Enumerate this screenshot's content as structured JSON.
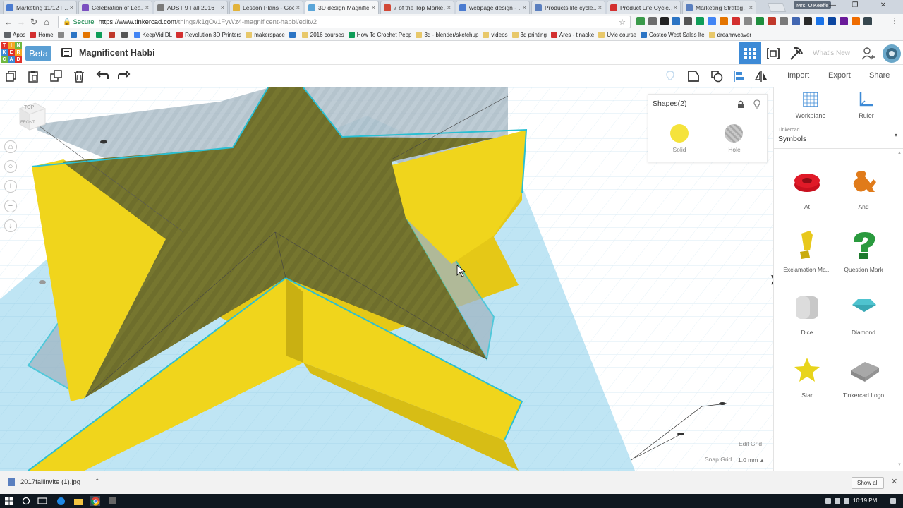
{
  "browser": {
    "tabs": [
      {
        "label": "Marketing 11/12 F…",
        "color": "#4a7bd0",
        "active": false
      },
      {
        "label": "Celebration of Lea…",
        "color": "#7b4fc0",
        "active": false
      },
      {
        "label": "ADST 9 Fall 2016",
        "color": "#7a7a7a",
        "active": false
      },
      {
        "label": "Lesson Plans - Goo…",
        "color": "#e2b33a",
        "active": false
      },
      {
        "label": "3D design Magnific…",
        "color": "#5aa5d8",
        "active": true
      },
      {
        "label": "7 of the Top Marke…",
        "color": "#d14836",
        "active": false
      },
      {
        "label": "webpage design - …",
        "color": "#4a7bd0",
        "active": false
      },
      {
        "label": "Products life cycle…",
        "color": "#5a7fbf",
        "active": false
      },
      {
        "label": "Product Life Cycle…",
        "color": "#d32f2f",
        "active": false
      },
      {
        "label": "Marketing Strateg…",
        "color": "#5a7fbf",
        "active": false
      }
    ],
    "tab_close": "×",
    "profile": "Mrs. O'Keeffe",
    "window_controls": {
      "minimize": "—",
      "maximize": "❐",
      "close": "✕"
    },
    "nav": {
      "back": "←",
      "forward": "→",
      "reload": "↻",
      "home": "⌂"
    },
    "secure_label": "🔒 Secure",
    "url_host": "https://www.tinkercad.com",
    "url_path": "/things/k1gOv1FyWz4-magnificent-habbi/editv2",
    "star": "☆",
    "bookmarks": [
      {
        "label": "Apps",
        "kind": "apps"
      },
      {
        "label": "Home",
        "kind": "site"
      },
      {
        "label": "",
        "kind": "site"
      },
      {
        "label": "",
        "kind": "site"
      },
      {
        "label": "",
        "kind": "site"
      },
      {
        "label": "",
        "kind": "site"
      },
      {
        "label": "",
        "kind": "site"
      },
      {
        "label": "",
        "kind": "site"
      },
      {
        "label": "KeepVid DL",
        "kind": "site"
      },
      {
        "label": "Revolution 3D Printers",
        "kind": "site"
      },
      {
        "label": "makerspace",
        "kind": "folder"
      },
      {
        "label": "",
        "kind": "site"
      },
      {
        "label": "2016 courses",
        "kind": "folder"
      },
      {
        "label": "How To Crochet Pepp",
        "kind": "site"
      },
      {
        "label": "3d - blender/sketchup",
        "kind": "folder"
      },
      {
        "label": "videos",
        "kind": "folder"
      },
      {
        "label": "3d printing",
        "kind": "folder"
      },
      {
        "label": "Ares - tinaoke",
        "kind": "site"
      },
      {
        "label": "Uvic course",
        "kind": "folder"
      },
      {
        "label": "Costco West Sales Ite",
        "kind": "site"
      },
      {
        "label": "dreamweaver",
        "kind": "folder"
      }
    ]
  },
  "app": {
    "logo_letters": [
      "TIN",
      "KER",
      "CAD"
    ],
    "beta_label": "Beta",
    "design_title": "Magnificent Habbi",
    "whats_new": "What's New",
    "colors": {
      "accent": "#3d8ad6",
      "beta": "#5a9fd4",
      "workplane": "#b9e3f3",
      "shape_yellow": "#f0d51c",
      "hole_teal": "#2bbfd2"
    }
  },
  "toolbar": {
    "import_label": "Import",
    "export_label": "Export",
    "share_label": "Share"
  },
  "canvas": {
    "viewcube_top": "TOP",
    "viewcube_front": "FRONT",
    "controls": [
      "⌂",
      "○",
      "+",
      "−",
      "↓"
    ],
    "edit_grid_label": "Edit Grid",
    "snap_grid_label": "Snap Grid",
    "snap_grid_value": "1.0 mm",
    "snap_grid_arrow": "▴"
  },
  "shapes_panel": {
    "title": "Shapes(2)",
    "solid_label": "Solid",
    "hole_label": "Hole"
  },
  "sidebar": {
    "workplane_label": "Workplane",
    "ruler_label": "Ruler",
    "library_sub": "Tinkercad",
    "library_name": "Symbols",
    "library_chevron": "▾",
    "collapse_arrow": "❯",
    "shapes": [
      {
        "label": "At",
        "color": "#c8101e",
        "kind": "at"
      },
      {
        "label": "And",
        "color": "#e07b1a",
        "kind": "and"
      },
      {
        "label": "Exclamation Ma...",
        "color": "#e8c81c",
        "kind": "exclamation"
      },
      {
        "label": "Question Mark",
        "color": "#2a9a3e",
        "kind": "question"
      },
      {
        "label": "Dice",
        "color": "#c8c8c8",
        "kind": "dice"
      },
      {
        "label": "Diamond",
        "color": "#4fc3cf",
        "kind": "diamond"
      },
      {
        "label": "Star",
        "color": "#e8d41c",
        "kind": "star"
      },
      {
        "label": "Tinkercad Logo",
        "color": "#a8a8a8",
        "kind": "logo"
      }
    ]
  },
  "downloads": {
    "file_name": "2017fallinvite (1).jpg",
    "chevron": "⌃",
    "show_all": "Show all",
    "close": "✕"
  },
  "taskbar": {
    "time": "10:19 PM"
  }
}
